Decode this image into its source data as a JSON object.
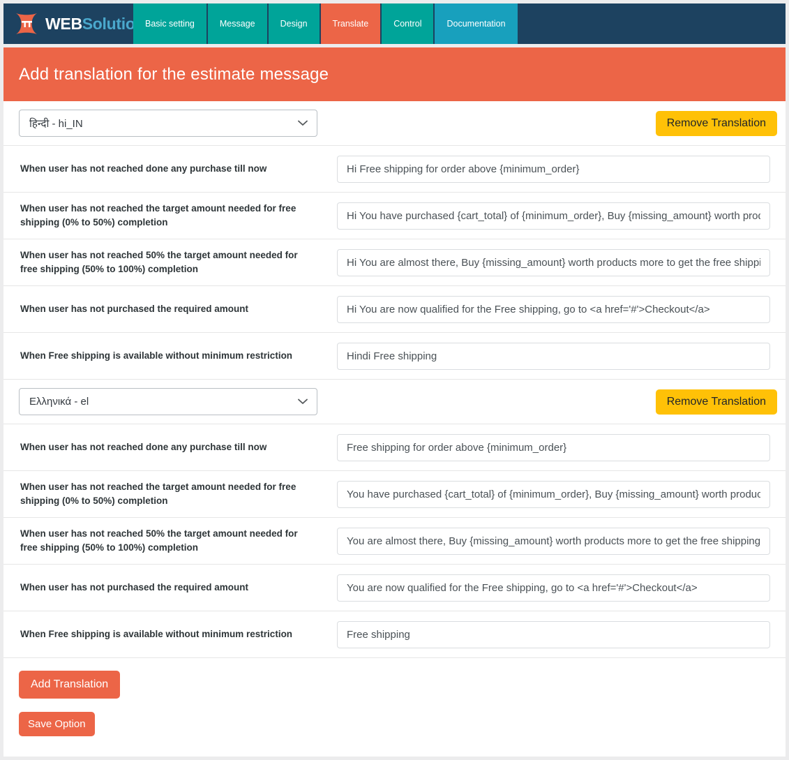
{
  "brand": {
    "word_web": "WEB",
    "word_solution": "Solution",
    "mark": "pi-butterfly-logo"
  },
  "nav": {
    "tabs": [
      {
        "label": "Basic setting",
        "style": "teal"
      },
      {
        "label": "Message",
        "style": "teal"
      },
      {
        "label": "Design",
        "style": "teal"
      },
      {
        "label": "Translate",
        "style": "active"
      },
      {
        "label": "Control",
        "style": "teal"
      },
      {
        "label": "Documentation",
        "style": "doc"
      }
    ]
  },
  "header": {
    "title": "Add translation for the estimate message"
  },
  "labels": {
    "no_purchase": "When user has not reached done any purchase till now",
    "target_0_50": "When user has not reached the target amount needed for free shipping (0% to 50%) completion",
    "target_50_100": "When user has not reached 50% the target amount needed for free shipping (50% to 100%) completion",
    "not_purchased_required": "When user has not purchased the required amount",
    "no_minimum": "When Free shipping is available without minimum restriction"
  },
  "buttons": {
    "remove_translation": "Remove Translation",
    "add_translation": "Add Translation",
    "save_option": "Save Option"
  },
  "icons": {
    "chevron_down": "⌄"
  },
  "colors": {
    "brand_navy": "#1d4260",
    "teal": "#00a499",
    "doc_blue": "#18a0bd",
    "orange": "#ec6547",
    "amber": "#ffc107",
    "page_bg": "#ececed"
  },
  "translations": [
    {
      "language": "हिन्दी - hi_IN",
      "values": {
        "no_purchase": "Hi Free shipping for order above {minimum_order}",
        "target_0_50": "Hi You have purchased {cart_total} of {minimum_order}, Buy {missing_amount} worth products more to get free shipping",
        "target_50_100": "Hi You are almost there, Buy {missing_amount} worth products more to get the free shipping",
        "not_purchased_required": "Hi You are now qualified for the Free shipping, go to <a href='#'>Checkout</a>",
        "no_minimum": "Hindi Free shipping"
      }
    },
    {
      "language": "Ελληνικά - el",
      "values": {
        "no_purchase": "Free shipping for order above {minimum_order}",
        "target_0_50": "You have purchased {cart_total} of {minimum_order}, Buy {missing_amount} worth products more to get free shipping",
        "target_50_100": "You are almost there, Buy {missing_amount} worth products more to get the free shipping",
        "not_purchased_required": "You are now qualified for the Free shipping, go to <a href='#'>Checkout</a>",
        "no_minimum": "Free shipping"
      }
    }
  ]
}
